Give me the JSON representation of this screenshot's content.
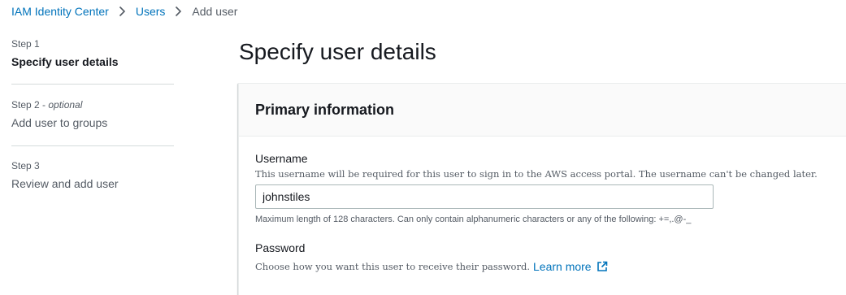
{
  "breadcrumb": {
    "items": [
      {
        "label": "IAM Identity Center",
        "link": true
      },
      {
        "label": "Users",
        "link": true
      },
      {
        "label": "Add user",
        "link": false
      }
    ]
  },
  "steps": [
    {
      "label": "Step 1",
      "optional": "",
      "title": "Specify user details",
      "active": true
    },
    {
      "label": "Step 2 - ",
      "optional": "optional",
      "title": "Add user to groups",
      "active": false
    },
    {
      "label": "Step 3",
      "optional": "",
      "title": "Review and add user",
      "active": false
    }
  ],
  "page": {
    "title": "Specify user details"
  },
  "primary": {
    "title": "Primary information",
    "username": {
      "label": "Username",
      "description": "This username will be required for this user to sign in to the AWS access portal. The username can't be changed later.",
      "value": "johnstiles",
      "constraint": "Maximum length of 128 characters. Can only contain alphanumeric characters or any of the following: +=,.@-_"
    },
    "password": {
      "label": "Password",
      "description": "Choose how you want this user to receive their password.",
      "learn_more": "Learn more",
      "learn_more_icon": "external-link-icon"
    }
  },
  "colors": {
    "link": "#0073bb",
    "text": "#16191f",
    "secondary": "#545b64"
  }
}
